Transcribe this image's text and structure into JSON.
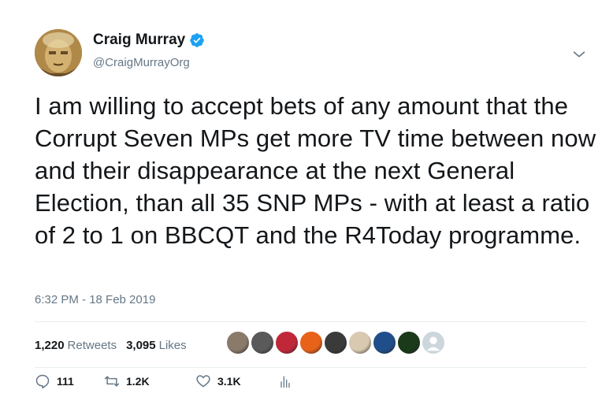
{
  "author": {
    "display_name": "Craig Murray",
    "handle": "@CraigMurrayOrg",
    "verified": true
  },
  "tweet": {
    "text": "I am willing to accept bets of any amount that the Corrupt Seven MPs get more TV time between now and their disappearance at the next General Election, than all 35 SNP MPs - with at least a ratio of 2 to 1 on BBCQT and the R4Today programme.",
    "timestamp": "6:32 PM - 18 Feb 2019"
  },
  "stats": {
    "retweets_count": "1,220",
    "retweets_label": "Retweets",
    "likes_count": "3,095",
    "likes_label": "Likes"
  },
  "likers": [
    {
      "icon": "liker-avatar-1",
      "color": "#8a7a6a"
    },
    {
      "icon": "liker-avatar-2",
      "color": "#5a5a5a"
    },
    {
      "icon": "liker-avatar-3",
      "color": "#c0283a"
    },
    {
      "icon": "liker-avatar-4",
      "color": "#e8621a"
    },
    {
      "icon": "liker-avatar-5",
      "color": "#3a3a3a"
    },
    {
      "icon": "liker-avatar-6",
      "color": "#d9c9b0"
    },
    {
      "icon": "liker-avatar-7",
      "color": "#1f4e8a"
    },
    {
      "icon": "liker-avatar-8",
      "color": "#1a3a1a"
    },
    {
      "icon": "liker-avatar-9",
      "color": "#ccd6dd"
    }
  ],
  "actions": {
    "reply_count": "111",
    "retweet_count": "1.2K",
    "like_count": "3.1K"
  },
  "colors": {
    "verified_blue": "#1da1f2",
    "secondary_text": "#657786",
    "divider": "#e6ecf0"
  }
}
